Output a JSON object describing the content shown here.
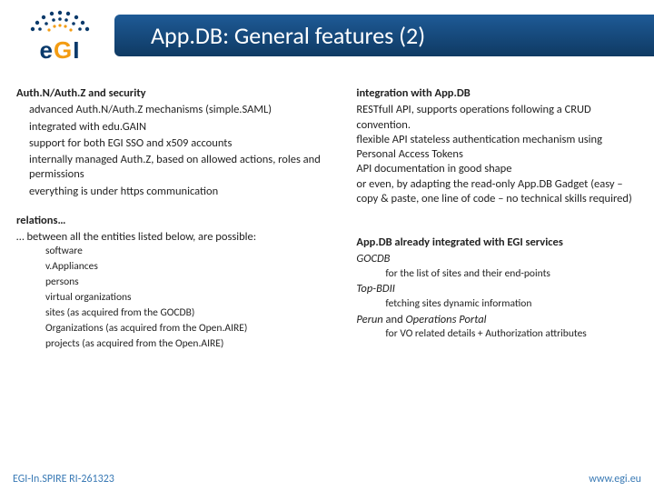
{
  "header": {
    "logo_text": "eGI",
    "title": "App.DB: General features (2)"
  },
  "left": {
    "sec1_heading": "Auth.N/Auth.Z and security",
    "sec1_items": [
      "advanced Auth.N/Auth.Z mechanisms (simple.SAML)",
      "integrated with edu.GAIN",
      "support for both EGI SSO and x509 accounts",
      "internally managed Auth.Z, based on allowed actions, roles and permissions",
      "everything is under https communication"
    ],
    "sec2_heading": "relations…",
    "sec2_intro": "… between all the entities listed below, are possible:",
    "sec2_items": [
      "software",
      "v.Appliances",
      "persons",
      "virtual organizations",
      "sites (as acquired from the GOCDB)",
      "Organizations (as acquired from the Open.AIRE)",
      "projects (as acquired from the Open.AIRE)"
    ]
  },
  "right": {
    "sec1_heading": "integration with App.DB",
    "sec1_l1": "RESTfull API, supports operations following a CRUD convention.",
    "sec1_l2": "flexible API stateless authentication mechanism using Personal Access Tokens",
    "sec1_l3": "API documentation in good shape",
    "sec1_l4": "or even, by adapting the read-only App.DB Gadget (easy – copy & paste, one line of code – no technical skills required)",
    "sec2_heading": "App.DB already integrated with EGI services",
    "sec2_a": "GOCDB",
    "sec2_a_sub": "for the list of sites and their end-points",
    "sec2_b": "Top-BDII",
    "sec2_b_sub": "fetching sites dynamic information",
    "sec2_c_pre": "Perun",
    "sec2_c_mid": " and ",
    "sec2_c_post": "Operations Portal",
    "sec2_c_sub1": "for VO related details + Authorization attributes"
  },
  "footer": {
    "left": "EGI-In.SPIRE RI-261323",
    "right": "www.egi.eu"
  }
}
